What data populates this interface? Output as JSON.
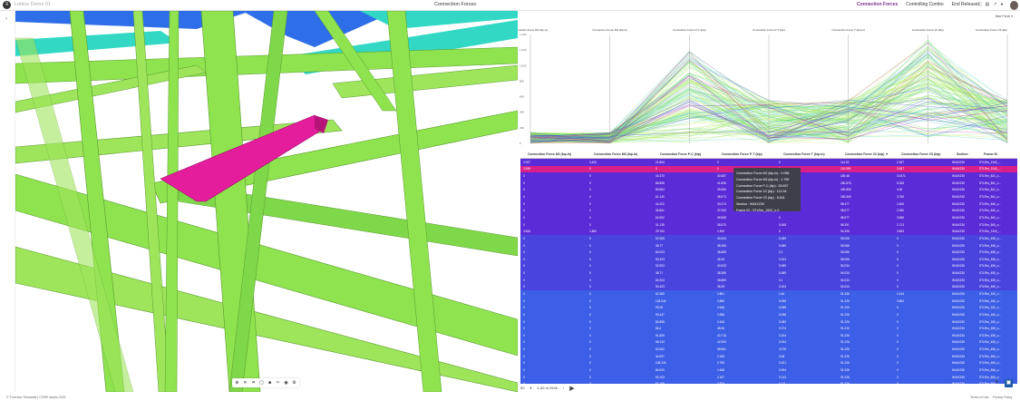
{
  "topbar": {
    "model_name": "Lattice Demo 01",
    "title": "Connection Forces",
    "tabs": [
      "Connection Forces",
      "Controlling Combo",
      "End Releases"
    ],
    "active_tab": 0
  },
  "parallel_chart": {
    "legend": "Max Force ▾",
    "axes": [
      "Connection Force M2 (kip-in)",
      "Connection Force M3 (kip-in)",
      "Connection Force P-C (kip)",
      "Connection Force P-T (kip)",
      "Connection Force T (kip-in)",
      "Connection Force V2 (kip)",
      "Connection Force V3 (kip)"
    ],
    "y_ticks": [
      "1,400",
      "1,200",
      "1,000",
      "800",
      "600",
      "400",
      "200",
      "0"
    ]
  },
  "grid": {
    "columns": [
      "Connection Force M2 (kip-in)",
      "Connection Force M3 (kip-in)",
      "Connection Force P-C (kip)",
      "Connection Force P-T (kip)",
      "Connection Force T (kip-in)",
      "Connection Force V2 (kip) ▼",
      "Connection Force V3 (kip)",
      "Section",
      "Frame ID"
    ],
    "rows": [
      {
        "c": [
          "2.937",
          "3,420",
          "21,894",
          "0",
          "0",
          "114.92",
          "2.187",
          "W44X230",
          "STLRm_1340_..."
        ],
        "bg": "#5a2bd6"
      },
      {
        "c": [
          "3.938",
          "0",
          "0",
          "0",
          "0",
          "116.909",
          "3.067",
          "W44X230",
          "STLRm_1340_..."
        ],
        "bg": "#d81f8a"
      },
      {
        "c": [
          "0",
          "0",
          "44.370",
          "40.587",
          "0",
          "180.48",
          "10.871",
          "W44X230",
          "STLRm_841_o..."
        ],
        "bg": "#5a2bd6"
      },
      {
        "c": [
          "0",
          "0",
          "86.855",
          "41.808",
          "0",
          "180.878",
          "5.265",
          "W44X230",
          "STLRm_841_o..."
        ],
        "bg": "#5a2bd6"
      },
      {
        "c": [
          "0",
          "0",
          "89.864",
          "39.950",
          "0",
          "180.809",
          "4.06",
          "W44X230",
          "STLRm_841_o..."
        ],
        "bg": "#5a2bd6"
      },
      {
        "c": [
          "0",
          "0",
          "61.130",
          "38.573",
          "0",
          "180.849",
          "3.755",
          "W44X230",
          "STLRm_841_o..."
        ],
        "bg": "#5a2bd6"
      },
      {
        "c": [
          "0",
          "0",
          "44.202",
          "40.374",
          "0",
          "98.477",
          "2.406",
          "W44X230",
          "STLRm_840_o..."
        ],
        "bg": "#5a2bd6"
      },
      {
        "c": [
          "0",
          "0",
          "36.861",
          "37.093",
          "0",
          "98.577",
          "2.260",
          "W44X230",
          "STLRm_840_o..."
        ],
        "bg": "#5a2bd6"
      },
      {
        "c": [
          "0",
          "0",
          "64.962",
          "39.588",
          "0",
          "98.977",
          "3.658",
          "W44X230",
          "STLRm_840_o..."
        ],
        "bg": "#5a2bd6"
      },
      {
        "c": [
          "0",
          "0",
          "31.135",
          "38.573",
          "0.008",
          "98.291",
          "2.713",
          "W44X230",
          "STLRm_840_o..."
        ],
        "bg": "#5a2bd6"
      },
      {
        "c": [
          "3.626",
          "1.860",
          "29.760",
          "1.450",
          "0",
          "94.336",
          "3.653",
          "W44X230",
          "STLRm_1340_..."
        ],
        "bg": "#5a2bd6"
      },
      {
        "c": [
          "0",
          "0",
          "92.965",
          "40.633",
          "0.089",
          "95.056",
          "0",
          "W44X230",
          "STLRm_455_o..."
        ],
        "bg": "#4a44df"
      },
      {
        "c": [
          "0",
          "0",
          "38.77",
          "38.385",
          "0.089",
          "95.056",
          "0",
          "W44X230",
          "STLRm_455_o..."
        ],
        "bg": "#4a44df"
      },
      {
        "c": [
          "0",
          "0",
          "60.203",
          "36.869",
          "0.1",
          "95.056",
          "0",
          "W44X230",
          "STLRm_455_o..."
        ],
        "bg": "#4a44df"
      },
      {
        "c": [
          "0",
          "0",
          "90.423",
          "38.35",
          "0.204",
          "95.056",
          "0",
          "W44X230",
          "STLRm_455_o..."
        ],
        "bg": "#4a44df"
      },
      {
        "c": [
          "0",
          "0",
          "92.993",
          "40.633",
          "0.089",
          "94.034",
          "0",
          "W44X230",
          "STLRm_455_o..."
        ],
        "bg": "#4a44df"
      },
      {
        "c": [
          "0",
          "0",
          "38.77",
          "38.385",
          "0.089",
          "94.034",
          "0",
          "W44X230",
          "STLRm_455_o..."
        ],
        "bg": "#4a44df"
      },
      {
        "c": [
          "0",
          "0",
          "60.203",
          "36.869",
          "0.1",
          "94.034",
          "0",
          "W44X230",
          "STLRm_455_o..."
        ],
        "bg": "#4a44df"
      },
      {
        "c": [
          "0",
          "0",
          "90.423",
          "38.35",
          "0.204",
          "94.034",
          "0",
          "W44X230",
          "STLRm_455_o..."
        ],
        "bg": "#4a44df"
      },
      {
        "c": [
          "0",
          "0",
          "62.380",
          "2.851",
          "1.64",
          "91.336",
          "0.144",
          "W44X230",
          "STLRm_100_o..."
        ],
        "bg": "#3d5ee6"
      },
      {
        "c": [
          "0",
          "0",
          "133.044",
          "2.850",
          "0.098",
          "91.226",
          "0.863",
          "W44X230",
          "STLRm_160_o..."
        ],
        "bg": "#3d5ee6"
      },
      {
        "c": [
          "0",
          "0",
          "93.28",
          "2.646",
          "0.098",
          "91.226",
          "0",
          "W44X230",
          "STLRm_160_o..."
        ],
        "bg": "#3d5ee6"
      },
      {
        "c": [
          "0",
          "0",
          "99.447",
          "2.596",
          "0.098",
          "91.226",
          "0",
          "W44X230",
          "STLRm_160_o..."
        ],
        "bg": "#3d5ee6"
      },
      {
        "c": [
          "0",
          "0",
          "84.898",
          "2.246",
          "0.082",
          "91.226",
          "0",
          "W44X230",
          "STLRm_160_o..."
        ],
        "bg": "#3d5ee6"
      },
      {
        "c": [
          "0",
          "0",
          "86.4",
          "38.36",
          "0.274",
          "91.226",
          "0",
          "W44X230",
          "STLRm_455_o..."
        ],
        "bg": "#3d5ee6"
      },
      {
        "c": [
          "0",
          "0",
          "91.805",
          "40.718",
          "0.204",
          "91.226",
          "0",
          "W44X230",
          "STLRm_455_o..."
        ],
        "bg": "#3d5ee6"
      },
      {
        "c": [
          "0",
          "0",
          "66.134",
          "42.909",
          "0.004",
          "91.226",
          "0",
          "W44X230",
          "STLRm_455_o..."
        ],
        "bg": "#3d5ee6"
      },
      {
        "c": [
          "0",
          "0",
          "52.602",
          "68.861",
          "0.076",
          "91.226",
          "0",
          "W44X230",
          "STLRm_455_o..."
        ],
        "bg": "#3d5ee6"
      },
      {
        "c": [
          "0",
          "0",
          "44.997",
          "2.196",
          "0.08",
          "91.226",
          "0",
          "W44X230",
          "STLRm_606_o..."
        ],
        "bg": "#3d5ee6"
      },
      {
        "c": [
          "0",
          "0",
          "108.226",
          "2.795",
          "0.201",
          "91.226",
          "0",
          "W44X230",
          "STLRm_606_o..."
        ],
        "bg": "#3d5ee6"
      },
      {
        "c": [
          "0",
          "0",
          "84.920",
          "1.648",
          "0.094",
          "91.226",
          "0",
          "W44X230",
          "STLRm_606_o..."
        ],
        "bg": "#3d5ee6"
      },
      {
        "c": [
          "0",
          "0",
          "90.103",
          "2.157",
          "0.133",
          "91.226",
          "0",
          "W44X230",
          "STLRm_606_o..."
        ],
        "bg": "#3d5ee6"
      },
      {
        "c": [
          "0",
          "0",
          "91.165",
          "2.826",
          "0.111",
          "91.226",
          "0",
          "W44X230",
          "STLRm_606_o..."
        ],
        "bg": "#3d5ee6"
      }
    ]
  },
  "tooltip": {
    "lines": [
      "Connection Force M2 (kip-in) : 0.058",
      "Connection Force M3 (kip-in) : 1.765",
      "Connection Force P-C (kip) : 25.837",
      "Connection Force V2 (kip) : 112.94",
      "Connection Force V3 (kip) : 8.841",
      "Section : W44X230",
      "Frame ID : STLRm_1532_o-0"
    ]
  },
  "pager": {
    "page_size": "50",
    "range": "1-50 of 2546"
  },
  "footer": {
    "left": "© Thornton Tomasetti | CORE studio 2025",
    "terms": "Terms of Use",
    "privacy": "Privacy Policy"
  },
  "colors": {
    "accent": "#7b2f8f",
    "structure_green": "#8fe34f",
    "structure_teal": "#32d8c4",
    "structure_blue": "#2e6ee8",
    "highlight_magenta": "#e41d9c"
  }
}
